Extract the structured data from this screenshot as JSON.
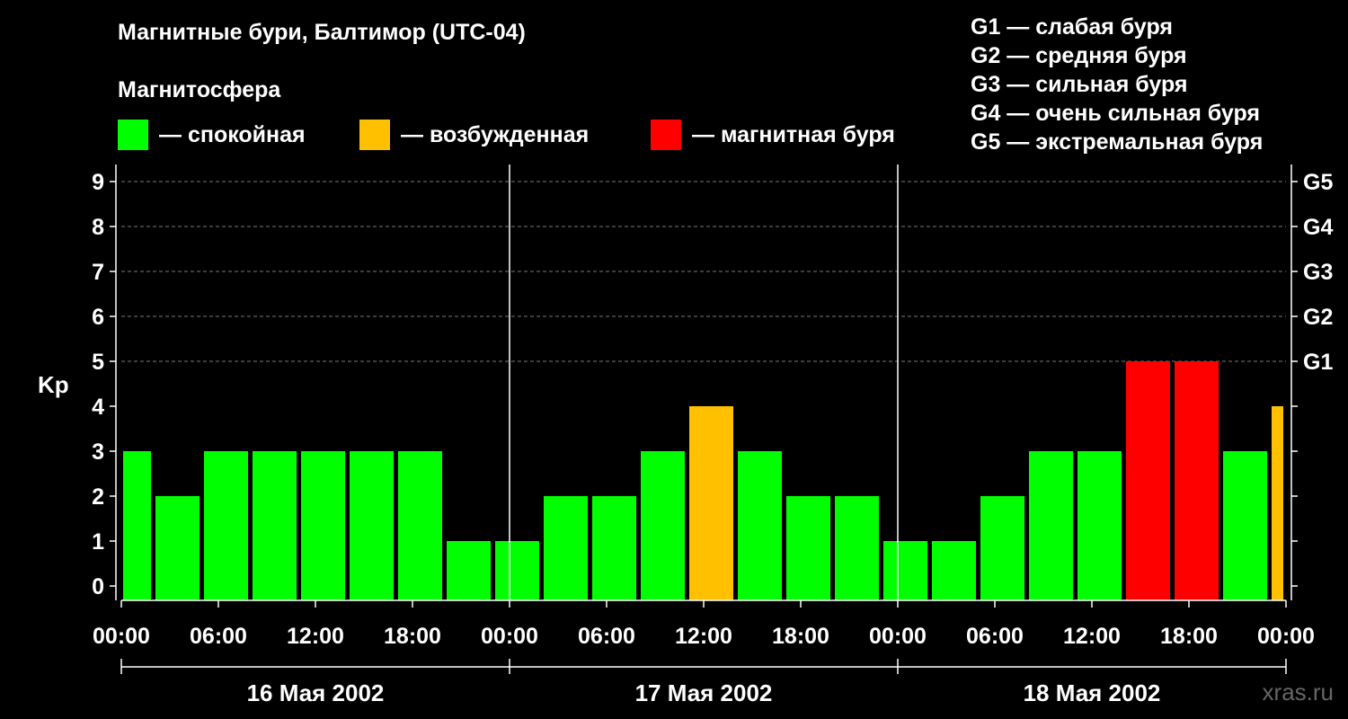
{
  "header": {
    "title": "Магнитные бури, Балтимор (UTC-04)",
    "subtitle": "Магнитосфера"
  },
  "legend": [
    {
      "label": "— спокойная",
      "color": "#00ff00"
    },
    {
      "label": "— возбужденная",
      "color": "#ffc000"
    },
    {
      "label": "— магнитная буря",
      "color": "#ff0000"
    }
  ],
  "storm_scale": [
    "G1 — слабая буря",
    "G2 — средняя буря",
    "G3 — сильная буря",
    "G4 — очень сильная буря",
    "G5 — экстремальная буря"
  ],
  "watermark": "xras.ru",
  "chart_data": {
    "type": "bar",
    "ylabel": "Kp",
    "ylim": [
      0,
      9
    ],
    "y_ticks": [
      "0",
      "1",
      "2",
      "3",
      "4",
      "5",
      "6",
      "7",
      "8",
      "9"
    ],
    "right_ticks": [
      {
        "kp": 5,
        "label": "G1"
      },
      {
        "kp": 6,
        "label": "G2"
      },
      {
        "kp": 7,
        "label": "G3"
      },
      {
        "kp": 8,
        "label": "G4"
      },
      {
        "kp": 9,
        "label": "G5"
      }
    ],
    "grid": "dashed horizontal at Kp 5-9",
    "x_tick_labels": [
      "00:00",
      "06:00",
      "12:00",
      "18:00",
      "00:00",
      "06:00",
      "12:00",
      "18:00",
      "00:00",
      "06:00",
      "12:00",
      "18:00",
      "00:00"
    ],
    "days": [
      "16 Мая 2002",
      "17 Мая 2002",
      "18 Мая 2002"
    ],
    "bars": [
      {
        "start_hour": 0,
        "end_hour": 2,
        "kp": 3,
        "level": "quiet"
      },
      {
        "start_hour": 2,
        "end_hour": 5,
        "kp": 2,
        "level": "quiet"
      },
      {
        "start_hour": 5,
        "end_hour": 8,
        "kp": 3,
        "level": "quiet"
      },
      {
        "start_hour": 8,
        "end_hour": 11,
        "kp": 3,
        "level": "quiet"
      },
      {
        "start_hour": 11,
        "end_hour": 14,
        "kp": 3,
        "level": "quiet"
      },
      {
        "start_hour": 14,
        "end_hour": 17,
        "kp": 3,
        "level": "quiet"
      },
      {
        "start_hour": 17,
        "end_hour": 20,
        "kp": 3,
        "level": "quiet"
      },
      {
        "start_hour": 20,
        "end_hour": 23,
        "kp": 1,
        "level": "quiet"
      },
      {
        "start_hour": 23,
        "end_hour": 26,
        "kp": 1,
        "level": "quiet"
      },
      {
        "start_hour": 26,
        "end_hour": 29,
        "kp": 2,
        "level": "quiet"
      },
      {
        "start_hour": 29,
        "end_hour": 32,
        "kp": 2,
        "level": "quiet"
      },
      {
        "start_hour": 32,
        "end_hour": 35,
        "kp": 3,
        "level": "quiet"
      },
      {
        "start_hour": 35,
        "end_hour": 38,
        "kp": 4,
        "level": "active"
      },
      {
        "start_hour": 38,
        "end_hour": 41,
        "kp": 3,
        "level": "quiet"
      },
      {
        "start_hour": 41,
        "end_hour": 44,
        "kp": 2,
        "level": "quiet"
      },
      {
        "start_hour": 44,
        "end_hour": 47,
        "kp": 2,
        "level": "quiet"
      },
      {
        "start_hour": 47,
        "end_hour": 50,
        "kp": 1,
        "level": "quiet"
      },
      {
        "start_hour": 50,
        "end_hour": 53,
        "kp": 1,
        "level": "quiet"
      },
      {
        "start_hour": 53,
        "end_hour": 56,
        "kp": 2,
        "level": "quiet"
      },
      {
        "start_hour": 56,
        "end_hour": 59,
        "kp": 3,
        "level": "quiet"
      },
      {
        "start_hour": 59,
        "end_hour": 62,
        "kp": 3,
        "level": "quiet"
      },
      {
        "start_hour": 62,
        "end_hour": 65,
        "kp": 5,
        "level": "storm"
      },
      {
        "start_hour": 65,
        "end_hour": 68,
        "kp": 5,
        "level": "storm"
      },
      {
        "start_hour": 68,
        "end_hour": 71,
        "kp": 3,
        "level": "quiet"
      },
      {
        "start_hour": 71,
        "end_hour": 72,
        "kp": 4,
        "level": "active"
      }
    ],
    "level_colors": {
      "quiet": "#00ff00",
      "active": "#ffc000",
      "storm": "#ff0000"
    }
  }
}
